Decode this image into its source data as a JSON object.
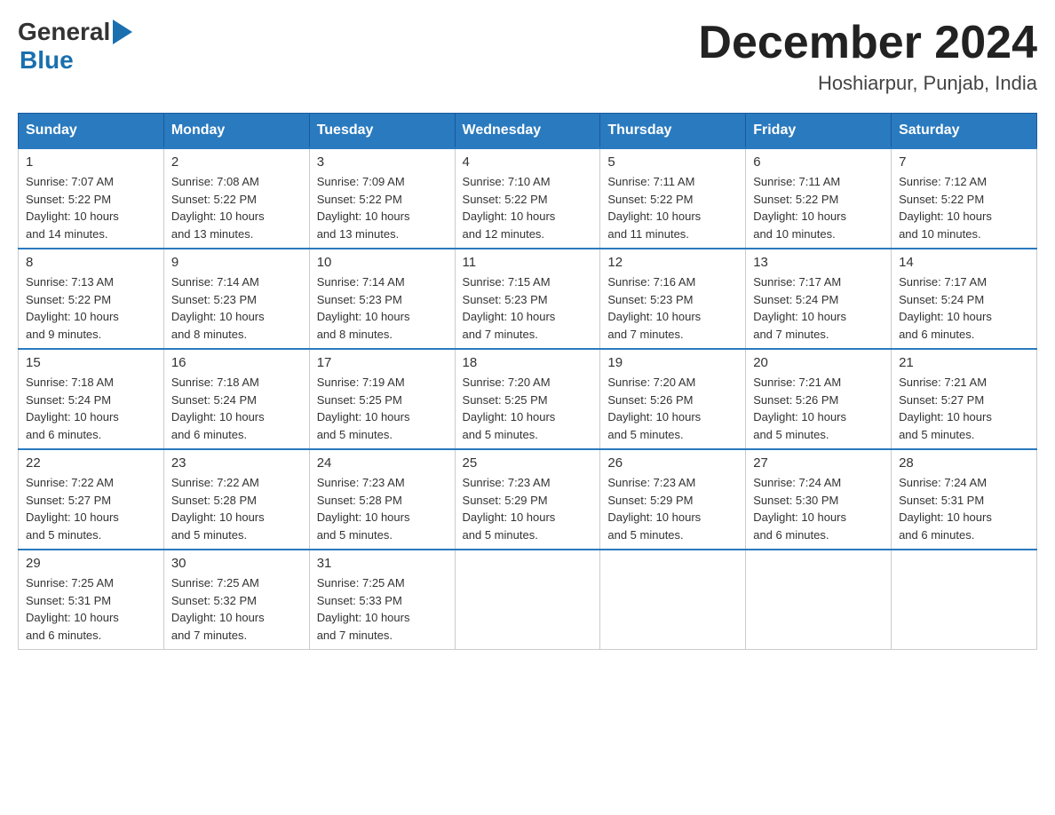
{
  "header": {
    "logo_general": "General",
    "logo_blue": "Blue",
    "month_title": "December 2024",
    "subtitle": "Hoshiarpur, Punjab, India"
  },
  "days_of_week": [
    "Sunday",
    "Monday",
    "Tuesday",
    "Wednesday",
    "Thursday",
    "Friday",
    "Saturday"
  ],
  "weeks": [
    [
      {
        "day": "1",
        "sunrise": "7:07 AM",
        "sunset": "5:22 PM",
        "daylight": "10 hours and 14 minutes."
      },
      {
        "day": "2",
        "sunrise": "7:08 AM",
        "sunset": "5:22 PM",
        "daylight": "10 hours and 13 minutes."
      },
      {
        "day": "3",
        "sunrise": "7:09 AM",
        "sunset": "5:22 PM",
        "daylight": "10 hours and 13 minutes."
      },
      {
        "day": "4",
        "sunrise": "7:10 AM",
        "sunset": "5:22 PM",
        "daylight": "10 hours and 12 minutes."
      },
      {
        "day": "5",
        "sunrise": "7:11 AM",
        "sunset": "5:22 PM",
        "daylight": "10 hours and 11 minutes."
      },
      {
        "day": "6",
        "sunrise": "7:11 AM",
        "sunset": "5:22 PM",
        "daylight": "10 hours and 10 minutes."
      },
      {
        "day": "7",
        "sunrise": "7:12 AM",
        "sunset": "5:22 PM",
        "daylight": "10 hours and 10 minutes."
      }
    ],
    [
      {
        "day": "8",
        "sunrise": "7:13 AM",
        "sunset": "5:22 PM",
        "daylight": "10 hours and 9 minutes."
      },
      {
        "day": "9",
        "sunrise": "7:14 AM",
        "sunset": "5:23 PM",
        "daylight": "10 hours and 8 minutes."
      },
      {
        "day": "10",
        "sunrise": "7:14 AM",
        "sunset": "5:23 PM",
        "daylight": "10 hours and 8 minutes."
      },
      {
        "day": "11",
        "sunrise": "7:15 AM",
        "sunset": "5:23 PM",
        "daylight": "10 hours and 7 minutes."
      },
      {
        "day": "12",
        "sunrise": "7:16 AM",
        "sunset": "5:23 PM",
        "daylight": "10 hours and 7 minutes."
      },
      {
        "day": "13",
        "sunrise": "7:17 AM",
        "sunset": "5:24 PM",
        "daylight": "10 hours and 7 minutes."
      },
      {
        "day": "14",
        "sunrise": "7:17 AM",
        "sunset": "5:24 PM",
        "daylight": "10 hours and 6 minutes."
      }
    ],
    [
      {
        "day": "15",
        "sunrise": "7:18 AM",
        "sunset": "5:24 PM",
        "daylight": "10 hours and 6 minutes."
      },
      {
        "day": "16",
        "sunrise": "7:18 AM",
        "sunset": "5:24 PM",
        "daylight": "10 hours and 6 minutes."
      },
      {
        "day": "17",
        "sunrise": "7:19 AM",
        "sunset": "5:25 PM",
        "daylight": "10 hours and 5 minutes."
      },
      {
        "day": "18",
        "sunrise": "7:20 AM",
        "sunset": "5:25 PM",
        "daylight": "10 hours and 5 minutes."
      },
      {
        "day": "19",
        "sunrise": "7:20 AM",
        "sunset": "5:26 PM",
        "daylight": "10 hours and 5 minutes."
      },
      {
        "day": "20",
        "sunrise": "7:21 AM",
        "sunset": "5:26 PM",
        "daylight": "10 hours and 5 minutes."
      },
      {
        "day": "21",
        "sunrise": "7:21 AM",
        "sunset": "5:27 PM",
        "daylight": "10 hours and 5 minutes."
      }
    ],
    [
      {
        "day": "22",
        "sunrise": "7:22 AM",
        "sunset": "5:27 PM",
        "daylight": "10 hours and 5 minutes."
      },
      {
        "day": "23",
        "sunrise": "7:22 AM",
        "sunset": "5:28 PM",
        "daylight": "10 hours and 5 minutes."
      },
      {
        "day": "24",
        "sunrise": "7:23 AM",
        "sunset": "5:28 PM",
        "daylight": "10 hours and 5 minutes."
      },
      {
        "day": "25",
        "sunrise": "7:23 AM",
        "sunset": "5:29 PM",
        "daylight": "10 hours and 5 minutes."
      },
      {
        "day": "26",
        "sunrise": "7:23 AM",
        "sunset": "5:29 PM",
        "daylight": "10 hours and 5 minutes."
      },
      {
        "day": "27",
        "sunrise": "7:24 AM",
        "sunset": "5:30 PM",
        "daylight": "10 hours and 6 minutes."
      },
      {
        "day": "28",
        "sunrise": "7:24 AM",
        "sunset": "5:31 PM",
        "daylight": "10 hours and 6 minutes."
      }
    ],
    [
      {
        "day": "29",
        "sunrise": "7:25 AM",
        "sunset": "5:31 PM",
        "daylight": "10 hours and 6 minutes."
      },
      {
        "day": "30",
        "sunrise": "7:25 AM",
        "sunset": "5:32 PM",
        "daylight": "10 hours and 7 minutes."
      },
      {
        "day": "31",
        "sunrise": "7:25 AM",
        "sunset": "5:33 PM",
        "daylight": "10 hours and 7 minutes."
      },
      null,
      null,
      null,
      null
    ]
  ],
  "labels": {
    "sunrise": "Sunrise:",
    "sunset": "Sunset:",
    "daylight": "Daylight:"
  }
}
